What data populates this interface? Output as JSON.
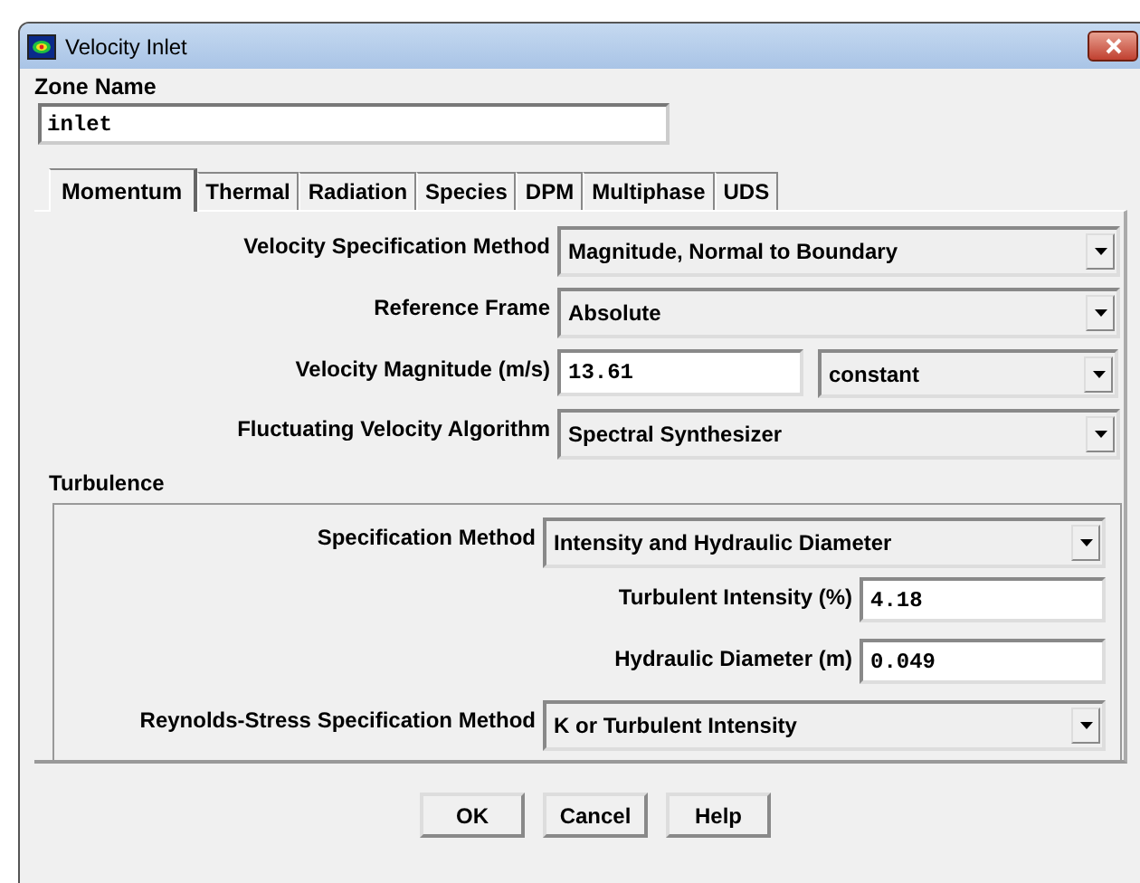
{
  "window": {
    "title": "Velocity Inlet"
  },
  "zone_name": {
    "label": "Zone Name",
    "value": "inlet"
  },
  "tabs": [
    {
      "label": "Momentum",
      "selected": true
    },
    {
      "label": "Thermal",
      "selected": false
    },
    {
      "label": "Radiation",
      "selected": false
    },
    {
      "label": "Species",
      "selected": false
    },
    {
      "label": "DPM",
      "selected": false
    },
    {
      "label": "Multiphase",
      "selected": false
    },
    {
      "label": "UDS",
      "selected": false
    }
  ],
  "momentum_fields": [
    {
      "kind": "dropdown",
      "label": "Velocity Specification Method",
      "value": "Magnitude, Normal to Boundary"
    },
    {
      "kind": "dropdown",
      "label": "Reference Frame",
      "value": "Absolute"
    },
    {
      "kind": "input_with_dropdown",
      "label": "Velocity Magnitude (m/s)",
      "value": "13.61",
      "option": "constant"
    },
    {
      "kind": "dropdown",
      "label": "Fluctuating Velocity Algorithm",
      "value": "Spectral Synthesizer"
    }
  ],
  "turbulence": {
    "title": "Turbulence",
    "fields": [
      {
        "kind": "dropdown",
        "label": "Specification Method",
        "value": "Intensity and Hydraulic Diameter"
      },
      {
        "kind": "input",
        "label": "Turbulent Intensity (%)",
        "value": "4.18"
      },
      {
        "kind": "input",
        "label": "Hydraulic Diameter (m)",
        "value": "0.049"
      },
      {
        "kind": "dropdown",
        "label": "Reynolds-Stress Specification Method",
        "value": "K or Turbulent Intensity"
      }
    ]
  },
  "buttons": [
    "OK",
    "Cancel",
    "Help"
  ]
}
